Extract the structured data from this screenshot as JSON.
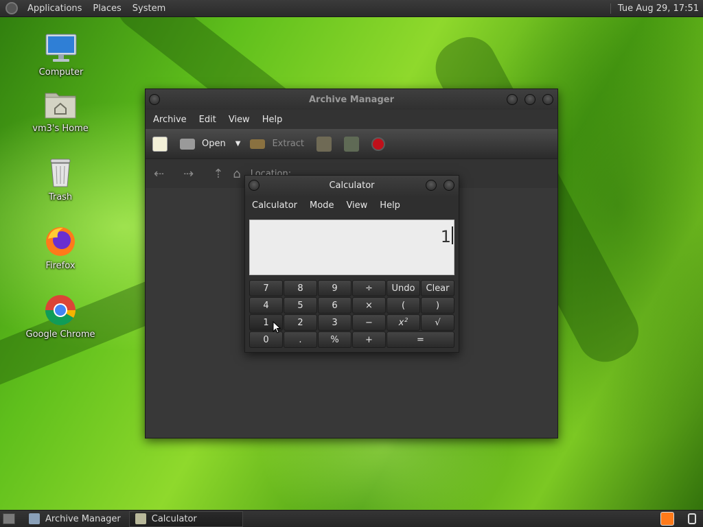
{
  "top_panel": {
    "menus": [
      "Applications",
      "Places",
      "System"
    ],
    "clock": "Tue Aug 29, 17:51"
  },
  "desktop_icons": [
    {
      "label": "Computer",
      "icon": "computer-icon"
    },
    {
      "label": "vm3's Home",
      "icon": "home-folder-icon"
    },
    {
      "label": "Trash",
      "icon": "trash-icon"
    },
    {
      "label": "Firefox",
      "icon": "firefox-icon"
    },
    {
      "label": "Google Chrome",
      "icon": "chrome-icon"
    }
  ],
  "archive_manager": {
    "title": "Archive Manager",
    "menu": [
      "Archive",
      "Edit",
      "View",
      "Help"
    ],
    "toolbar": {
      "open_label": "Open",
      "extract_label": "Extract"
    },
    "location_label": "Location:"
  },
  "calculator": {
    "title": "Calculator",
    "menu": [
      "Calculator",
      "Mode",
      "View",
      "Help"
    ],
    "display_value": "1",
    "keys": [
      [
        "7",
        "8",
        "9",
        "÷",
        "Undo",
        "Clear"
      ],
      [
        "4",
        "5",
        "6",
        "×",
        "(",
        ")"
      ],
      [
        "1",
        "2",
        "3",
        "−",
        "x",
        "√"
      ],
      [
        "0",
        ".",
        "%",
        "+",
        "="
      ]
    ],
    "square_superscript": "2"
  },
  "taskbar": {
    "tasks": [
      "Archive Manager",
      "Calculator"
    ],
    "active_task": "Calculator"
  },
  "colors": {
    "panel": "#2a2a2a",
    "window_bg": "#333333",
    "display_bg": "#ececec",
    "stop_button": "#c0101a"
  }
}
